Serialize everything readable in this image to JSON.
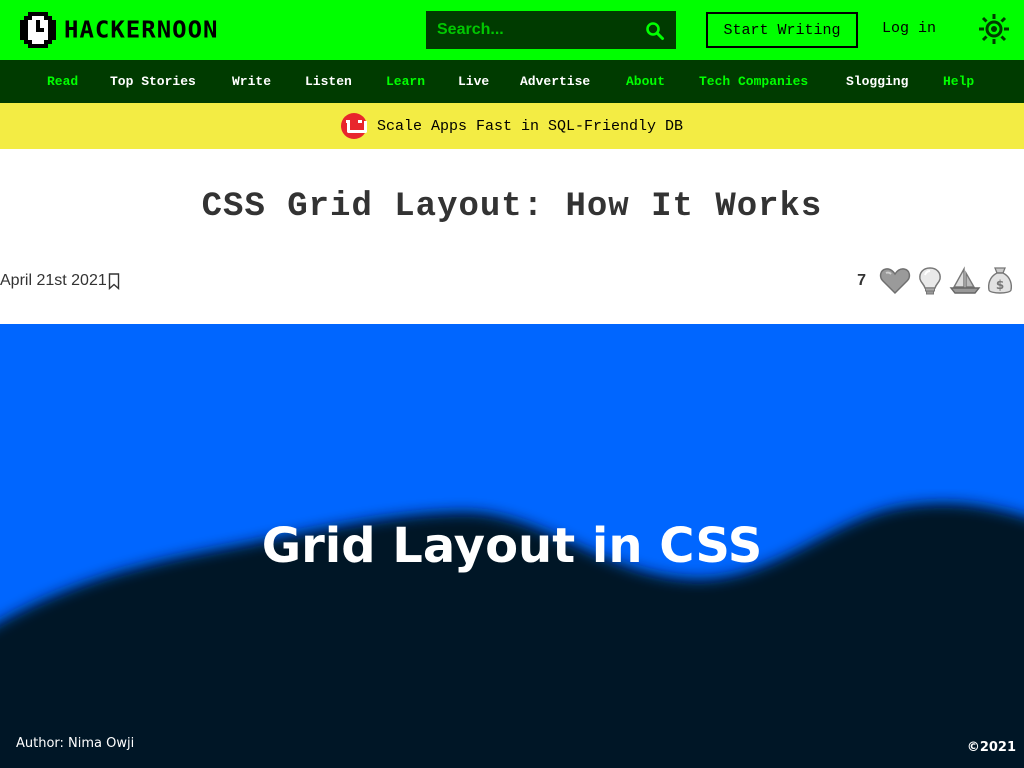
{
  "header": {
    "logo_text": "HACKERNOON",
    "search_placeholder": "Search...",
    "start_writing": "Start Writing",
    "login": "Log in",
    "accent": "#00ff00"
  },
  "nav": {
    "items": [
      {
        "label": "Read",
        "color": "#00ff00"
      },
      {
        "label": "Top Stories",
        "color": "#ffffff"
      },
      {
        "label": "Write",
        "color": "#ffffff"
      },
      {
        "label": "Listen",
        "color": "#ffffff"
      },
      {
        "label": "Learn",
        "color": "#00ff00"
      },
      {
        "label": "Live",
        "color": "#ffffff"
      },
      {
        "label": "Advertise",
        "color": "#ffffff"
      },
      {
        "label": "About",
        "color": "#00ff00"
      },
      {
        "label": "Tech Companies",
        "color": "#00ff00"
      },
      {
        "label": "Slogging",
        "color": "#ffffff"
      },
      {
        "label": "Help",
        "color": "#00ff00"
      }
    ]
  },
  "banner": {
    "text": "Scale Apps Fast in SQL-Friendly DB",
    "icon": "couchbase-logo-icon"
  },
  "article": {
    "title": "CSS Grid Layout: How It Works",
    "date": "April 21st 2021",
    "reaction_count": "7",
    "reactions": [
      "heart-icon",
      "lightbulb-icon",
      "boat-icon",
      "money-bag-icon"
    ]
  },
  "hero": {
    "title": "Grid Layout in CSS",
    "author": "Author: Nima Owji",
    "copyright": "©2021"
  }
}
